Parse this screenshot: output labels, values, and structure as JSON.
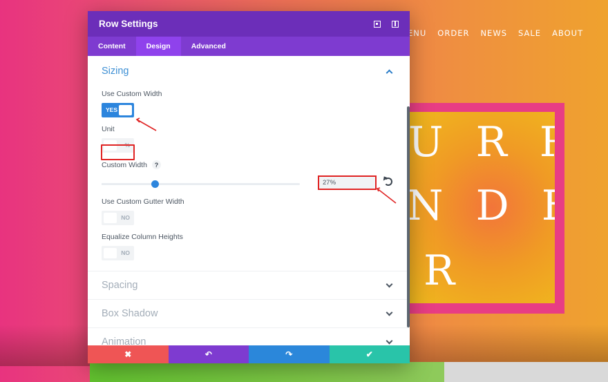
{
  "background": {
    "nav": [
      "ENU",
      "ORDER",
      "NEWS",
      "SALE",
      "ABOUT"
    ],
    "hero_lines": [
      "U R R",
      "N D E",
      "R"
    ]
  },
  "modal": {
    "title": "Row Settings",
    "tabs": [
      {
        "label": "Content",
        "active": false
      },
      {
        "label": "Design",
        "active": true
      },
      {
        "label": "Advanced",
        "active": false
      }
    ],
    "sizing": {
      "title": "Sizing",
      "use_custom_width": {
        "label": "Use Custom Width",
        "toggle_text": "YES",
        "on": true
      },
      "unit": {
        "label": "Unit",
        "toggle_text": "%",
        "on": false
      },
      "custom_width": {
        "label": "Custom Width",
        "help": "?",
        "value": "27%",
        "slider_fraction": 0.27
      },
      "use_custom_gutter_width": {
        "label": "Use Custom Gutter Width",
        "toggle_text": "NO",
        "on": false
      },
      "equalize_column_heights": {
        "label": "Equalize Column Heights",
        "toggle_text": "NO",
        "on": false
      }
    },
    "collapsed_sections": [
      "Spacing",
      "Box Shadow",
      "Animation"
    ],
    "footer": {
      "discard": "✖",
      "undo": "↶",
      "redo": "↷",
      "save": "✔"
    }
  },
  "colors": {
    "header": "#6c2eb9",
    "tabs": "#7e3bd0",
    "accent_blue": "#2c85dd",
    "highlight_red": "#e02323",
    "discard": "#ef5555",
    "save": "#29c4a9"
  }
}
